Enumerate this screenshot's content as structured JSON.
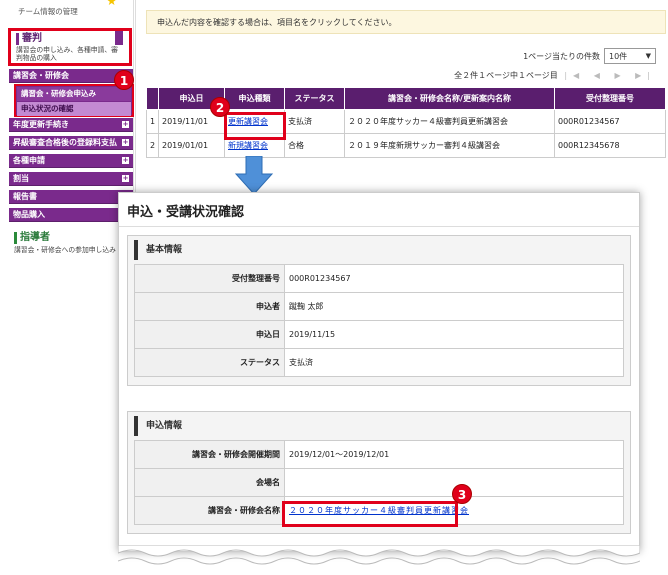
{
  "sidebar": {
    "top_text": "チーム情報の管理",
    "section1": {
      "title": "審判",
      "desc": "講習会の申し込み、各種申請、審判物品の購入"
    },
    "menu_open": "講習会・研修会",
    "sub_items": [
      "講習会・研修会申込み",
      "申込状況の確認"
    ],
    "items": [
      "年度更新手続き",
      "昇級審査合格後の登録料支払",
      "各種申請",
      "割当",
      "報告書",
      "物品購入"
    ],
    "section2": {
      "title": "指導者",
      "desc": "講習会・研修会への参加申し込み"
    }
  },
  "badges": [
    "1",
    "2",
    "3"
  ],
  "main": {
    "notice": "申込んだ内容を確認する場合は、項目名をクリックしてください。",
    "per_page_label": "1ページ当たりの件数",
    "per_page_value": "10件",
    "counter": "全２件１ページ中１ページ目",
    "nav": "|◀ ◀ ▶ ▶|",
    "table": {
      "headers": [
        "",
        "申込日",
        "申込種類",
        "ステータス",
        "講習会・研修会名称/更新案内名称",
        "受付整理番号"
      ],
      "rows": [
        [
          "1",
          "2019/11/01",
          "更新講習会",
          "支払済",
          "２０２０年度サッカー４級審判員更新講習会",
          "000R01234567"
        ],
        [
          "2",
          "2019/01/01",
          "新規講習会",
          "合格",
          "２０１９年度新規サッカー審判４級講習会",
          "000R12345678"
        ]
      ]
    }
  },
  "panel": {
    "title": "申込・受講状況確認",
    "basic": {
      "heading": "基本情報",
      "rows": [
        {
          "k": "受付整理番号",
          "v": "000R01234567"
        },
        {
          "k": "申込者",
          "v": "蹴鞠 太郎"
        },
        {
          "k": "申込日",
          "v": "2019/11/15"
        },
        {
          "k": "ステータス",
          "v": "支払済"
        }
      ]
    },
    "apply": {
      "heading": "申込情報",
      "rows": [
        {
          "k": "講習会・研修会開催期間",
          "v": "2019/12/01～2019/12/01"
        },
        {
          "k": "会場名",
          "v": ""
        },
        {
          "k": "講習会・研修会名称",
          "v": "２０２０年度サッカー４級審判員更新講習会"
        }
      ]
    }
  }
}
